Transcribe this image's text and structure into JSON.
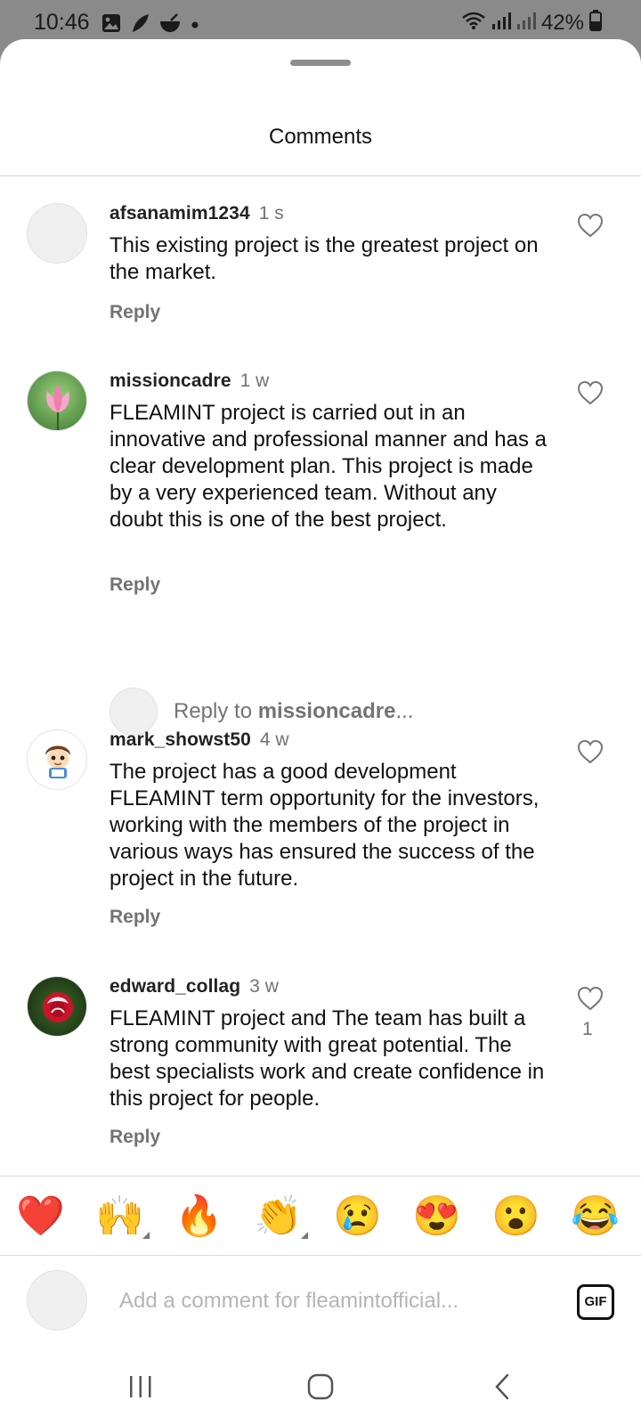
{
  "status_bar": {
    "time": "10:46",
    "notification_icons": [
      "gallery-icon",
      "leaf-icon",
      "bowl-icon",
      "dot-icon"
    ],
    "battery_percent": "42%"
  },
  "sheet": {
    "title": "Comments"
  },
  "comments": [
    {
      "username": "afsanamim1234",
      "time": "1 s",
      "text": "This existing project is the greatest project on the market.",
      "reply_label": "Reply",
      "likes": ""
    },
    {
      "username": "missioncadre",
      "time": "1 w",
      "text": "FLEAMINT project is carried out in an innovative and professional manner and has a clear development plan. This project is made by a very experienced team. Without any doubt this is one of the best project.",
      "reply_label": "Reply",
      "likes": ""
    },
    {
      "username": "mark_showst50",
      "time": "4 w",
      "text": "The project has a good development FLEAMINT term opportunity for the investors, working with the members of the project in various ways has ensured the success of the project in the future.",
      "reply_label": "Reply",
      "likes": ""
    },
    {
      "username": "edward_collag",
      "time": "3 w",
      "text": "FLEAMINT project and The team has built a strong community with great potential. The best specialists work and create confidence in this project for people.",
      "reply_label": "Reply",
      "likes": "1"
    }
  ],
  "reply_prompt": {
    "prefix": "Reply to ",
    "username": "missioncadre",
    "suffix": "..."
  },
  "emoji_bar": [
    "❤️",
    "🙌",
    "🔥",
    "👏",
    "😢",
    "😍",
    "😮",
    "😂"
  ],
  "comment_input": {
    "placeholder": "Add a comment for fleamintofficial...",
    "gif_label": "GIF"
  },
  "nav_bar": [
    "recents-icon",
    "home-icon",
    "back-icon"
  ]
}
